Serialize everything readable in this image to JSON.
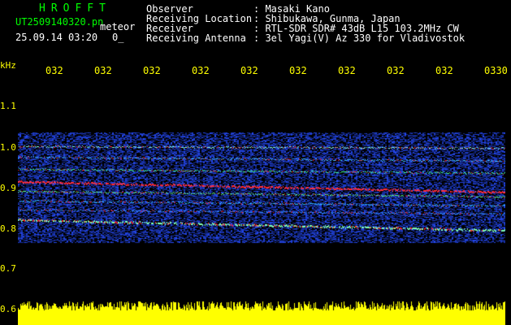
{
  "header": {
    "brand": "HROFFT",
    "filename": "UT2509140320.pn",
    "detection_label": "meteor",
    "datetime": "25.09.14 03:20",
    "count": "0_"
  },
  "info": [
    {
      "label": "Observer",
      "value": ": Masaki Kano"
    },
    {
      "label": "Receiving Location",
      "value": ": Shibukawa, Gunma, Japan"
    },
    {
      "label": "Receiver",
      "value": ": RTL-SDR SDR# 43dB L15 103.2MHz CW"
    },
    {
      "label": "Receiving Antenna",
      "value": ": 3el Yagi(V) Az 330 for Vladivostok"
    }
  ],
  "axis": {
    "y_unit": "kHz",
    "y_ticks": [
      "1.1",
      "1.0",
      "0.9",
      "0.8",
      "0.7",
      "0.6"
    ],
    "x_ticks": [
      "032",
      "032",
      "032",
      "032",
      "032",
      "032",
      "032",
      "032",
      "032",
      "0330"
    ]
  },
  "colors": {
    "signal_red": "#ff2020",
    "signal_green": "#20ff60",
    "noise_blue": "#2040ff",
    "bar_yellow": "#ffff00",
    "text_green": "#00ff00"
  }
}
